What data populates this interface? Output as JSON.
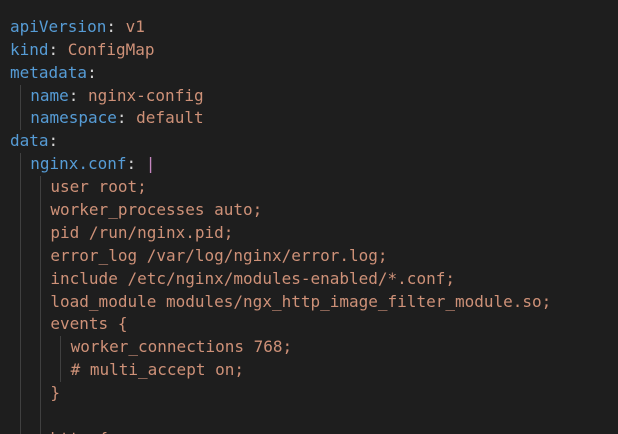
{
  "editor": {
    "colors": {
      "background": "#1e1e1e",
      "key": "#569cd6",
      "punctuation": "#d4d4d4",
      "value": "#ce9178",
      "block_indicator": "#c586c0",
      "indent_guide": "#404040"
    },
    "lines": [
      {
        "indent": 0,
        "key": "",
        "sep": "",
        "value": "",
        "text": "",
        "partial_top": true
      },
      {
        "indent": 0,
        "key": "apiVersion",
        "sep": ":",
        "value": " v1"
      },
      {
        "indent": 0,
        "key": "kind",
        "sep": ":",
        "value": " ConfigMap"
      },
      {
        "indent": 0,
        "key": "metadata",
        "sep": ":",
        "value": ""
      },
      {
        "indent": 1,
        "key": "name",
        "sep": ":",
        "value": " nginx-config"
      },
      {
        "indent": 1,
        "key": "namespace",
        "sep": ":",
        "value": " default"
      },
      {
        "indent": 0,
        "key": "data",
        "sep": ":",
        "value": ""
      },
      {
        "indent": 1,
        "key": "nginx.conf",
        "sep": ":",
        "value": " ",
        "block": "|"
      },
      {
        "indent": 2,
        "text": "user root;"
      },
      {
        "indent": 2,
        "text": "worker_processes auto;"
      },
      {
        "indent": 2,
        "text": "pid /run/nginx.pid;"
      },
      {
        "indent": 2,
        "text": "error_log /var/log/nginx/error.log;"
      },
      {
        "indent": 2,
        "text": "include /etc/nginx/modules-enabled/*.conf;"
      },
      {
        "indent": 2,
        "text": "load_module modules/ngx_http_image_filter_module.so;"
      },
      {
        "indent": 2,
        "text": "events {"
      },
      {
        "indent": 3,
        "text": "worker_connections 768;"
      },
      {
        "indent": 3,
        "text": "# multi_accept on;"
      },
      {
        "indent": 2,
        "text": "}"
      },
      {
        "indent": 2,
        "text": ""
      },
      {
        "indent": 2,
        "text": "http {"
      }
    ]
  }
}
